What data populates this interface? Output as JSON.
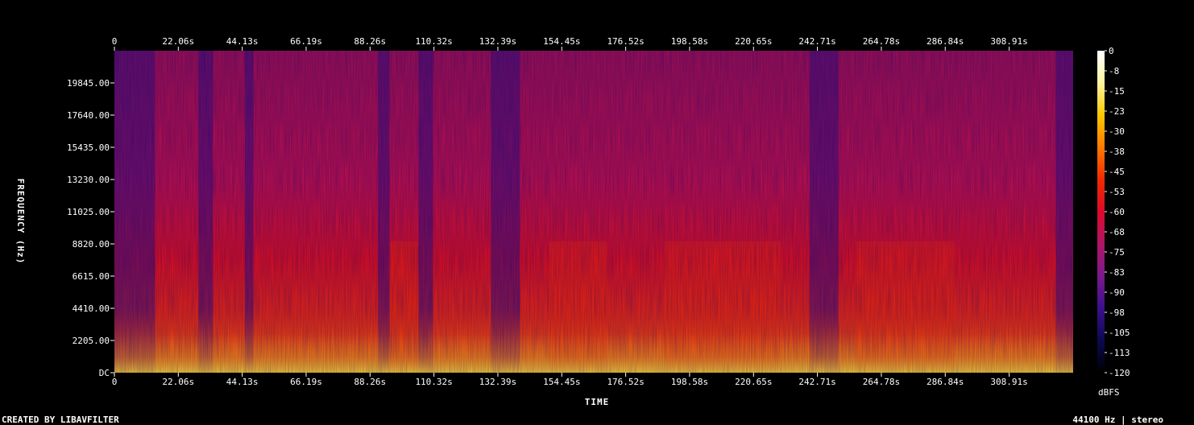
{
  "chart_data": {
    "type": "heatmap",
    "title": "",
    "xlabel": "TIME",
    "ylabel": "FREQUENCY (Hz)",
    "x_tick_labels": [
      "0",
      "22.06s",
      "44.13s",
      "66.19s",
      "88.26s",
      "110.32s",
      "132.39s",
      "154.45s",
      "176.52s",
      "198.58s",
      "220.65s",
      "242.71s",
      "264.78s",
      "286.84s",
      "308.91s"
    ],
    "x_tick_values_s": [
      0,
      22.06,
      44.13,
      66.19,
      88.26,
      110.32,
      132.39,
      154.45,
      176.52,
      198.58,
      220.65,
      242.71,
      264.78,
      286.84,
      308.91
    ],
    "x_range_s": [
      0,
      331
    ],
    "y_tick_labels": [
      "DC",
      "2205.00",
      "4410.00",
      "6615.00",
      "8820.00",
      "11025.00",
      "13230.00",
      "15435.00",
      "17640.00",
      "19845.00"
    ],
    "y_tick_values_hz": [
      0,
      2205,
      4410,
      6615,
      8820,
      11025,
      13230,
      15435,
      17640,
      19845
    ],
    "y_range_hz": [
      0,
      22050
    ],
    "colorbar": {
      "label": "dBFS",
      "tick_labels": [
        "0",
        "-8",
        "-15",
        "-23",
        "-30",
        "-38",
        "-45",
        "-53",
        "-60",
        "-68",
        "-75",
        "-83",
        "-90",
        "-98",
        "-105",
        "-113",
        "-120"
      ],
      "range_db": [
        -120,
        0
      ],
      "colors": [
        "#000000",
        "#0a0a50",
        "#3c0f8c",
        "#7a1a8a",
        "#b01565",
        "#dc0a2a",
        "#f02a00",
        "#ff7a00",
        "#ffc800",
        "#fff5a0",
        "#ffffff"
      ]
    },
    "quiet_segments_s": [
      [
        0,
        14
      ],
      [
        29,
        34
      ],
      [
        45,
        48
      ],
      [
        91,
        95
      ],
      [
        105,
        110
      ],
      [
        130,
        140
      ],
      [
        240,
        250
      ],
      [
        325,
        331
      ]
    ],
    "loud_segments_s": [
      [
        95,
        105
      ],
      [
        150,
        170
      ],
      [
        190,
        230
      ],
      [
        256,
        290
      ]
    ]
  },
  "footer": {
    "credit": "CREATED BY LIBAVFILTER",
    "info": "44100 Hz | stereo"
  }
}
